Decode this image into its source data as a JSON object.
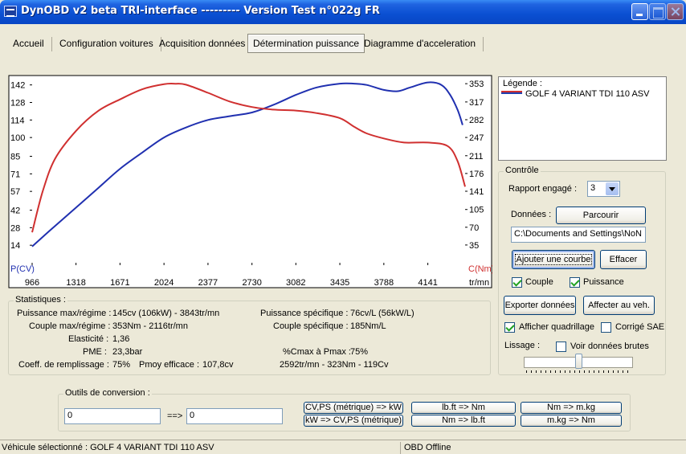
{
  "window": {
    "title": "DynOBD v2 beta TRI-interface --------- Version Test n°022g FR"
  },
  "tabs": [
    {
      "label": "Accueil"
    },
    {
      "label": "Configuration voitures"
    },
    {
      "label": "Acquisition données"
    },
    {
      "label": "Détermination puissance",
      "active": true
    },
    {
      "label": "Diagramme d'acceleration"
    }
  ],
  "chart_data": {
    "type": "line",
    "left_axis_title": "P(CV)",
    "right_axis_title": "C(Nm)",
    "x_axis_unit": "tr/mn",
    "x_ticks": [
      "966",
      "1318",
      "1671",
      "2024",
      "2377",
      "2730",
      "3082",
      "3435",
      "3788",
      "4141"
    ],
    "left_ticks": [
      "142",
      "128",
      "114",
      "100",
      "85",
      "71",
      "57",
      "42",
      "28",
      "14"
    ],
    "right_ticks": [
      "353",
      "317",
      "282",
      "247",
      "211",
      "176",
      "141",
      "105",
      "70",
      "35"
    ],
    "xlim": [
      966,
      4440
    ],
    "left_ylim": [
      0,
      145
    ],
    "right_ylim": [
      0,
      358
    ],
    "grid": false,
    "series": [
      {
        "name": "GOLF 4 VARIANT TDI 110 ASV",
        "axis": "left",
        "color": "#2030b0",
        "x": [
          966,
          1100,
          1318,
          1500,
          1671,
          1850,
          2024,
          2200,
          2377,
          2550,
          2730,
          2900,
          3082,
          3250,
          3435,
          3550,
          3650,
          3788,
          3900,
          4000,
          4141,
          4250,
          4320,
          4380,
          4420
        ],
        "y": [
          13,
          25,
          44,
          60,
          75,
          88,
          100,
          108,
          114,
          117,
          120,
          126,
          134,
          140,
          143,
          143,
          142,
          138,
          137,
          140,
          144,
          142,
          134,
          122,
          110
        ]
      },
      {
        "name": "GOLF 4 VARIANT TDI 110 ASV",
        "axis": "right",
        "color": "#d03030",
        "x": [
          966,
          1050,
          1150,
          1318,
          1500,
          1671,
          1850,
          2024,
          2116,
          2200,
          2377,
          2550,
          2730,
          2900,
          3082,
          3250,
          3435,
          3550,
          3650,
          3788,
          3950,
          4141,
          4300,
          4380,
          4440
        ],
        "y": [
          60,
          140,
          205,
          260,
          300,
          322,
          342,
          352,
          353,
          351,
          335,
          318,
          307,
          302,
          300,
          295,
          285,
          268,
          255,
          245,
          237,
          237,
          230,
          200,
          150
        ]
      }
    ]
  },
  "legend": {
    "title": "Légende :",
    "entries": [
      {
        "label": "GOLF 4 VARIANT TDI 110 ASV"
      }
    ]
  },
  "stats": {
    "title": "Statistiques :",
    "rows": [
      {
        "label": "Puissance max/régime :",
        "value": "145cv (106kW) - 3843tr/mn"
      },
      {
        "label": "Couple max/régime :",
        "value": "353Nm - 2116tr/mn"
      },
      {
        "label": "Elasticité :",
        "value": "1,36"
      },
      {
        "label": "PME :",
        "value": "23,3bar"
      },
      {
        "label": "Coeff. de remplissage :",
        "value": "75%"
      }
    ],
    "pmoy_label": "Pmoy efficace :",
    "pmoy_value": "107,8cv",
    "right_rows": [
      {
        "label": "Puissance spécifique :",
        "value": "76cv/L (56kW/L)"
      },
      {
        "label": "Couple spécifique :",
        "value": "185Nm/L"
      }
    ],
    "cmax_label": "%Cmax à Pmax :",
    "cmax_value": "75%",
    "cmax_detail": "2592tr/mn - 323Nm - 119Cv"
  },
  "controle": {
    "title": "Contrôle",
    "rapport_label": "Rapport engagé :",
    "rapport_value": "3",
    "donnees_label": "Données :",
    "parcourir": "Parcourir",
    "path": "C:\\Documents and Settings\\NoN",
    "ajouter": "Ajouter une courbe",
    "effacer": "Effacer",
    "couple": "Couple",
    "puissance": "Puissance",
    "exporter": "Exporter données",
    "affecter": "Affecter au veh.",
    "quadrillage": "Afficher quadrillage",
    "corrige": "Corrigé SAE",
    "lissage": "Lissage :",
    "brutes": "Voir données brutes"
  },
  "conversion": {
    "title": "Outils de conversion :",
    "input_value": "0",
    "arrow": "==>",
    "output_value": "0",
    "buttons": [
      "CV,PS (métrique) => kW",
      "kW => CV,PS (métrique)",
      "lb.ft => Nm",
      "Nm => lb.ft",
      "Nm => m.kg",
      "m.kg => Nm"
    ]
  },
  "statusbar": {
    "vehicle": "Véhicule sélectionné : GOLF 4 VARIANT TDI 110 ASV",
    "obd": "OBD Offline"
  }
}
